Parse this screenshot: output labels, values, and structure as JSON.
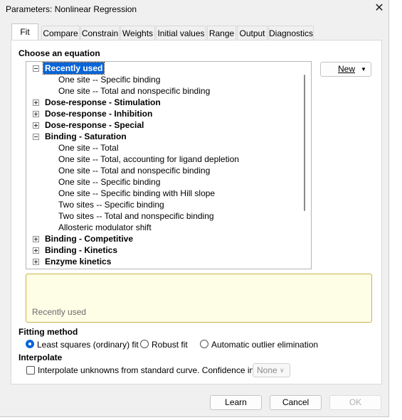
{
  "window": {
    "title": "Parameters: Nonlinear Regression",
    "close_glyph": "✕"
  },
  "tabs": [
    "Fit",
    "Compare",
    "Constrain",
    "Weights",
    "Initial values",
    "Range",
    "Output",
    "Diagnostics"
  ],
  "active_tab": "Fit",
  "choose_equation_label": "Choose an equation",
  "new_button": {
    "label": "New",
    "arrow": "▼"
  },
  "tree": [
    {
      "type": "category",
      "label": "Recently used",
      "expanded": true,
      "selected": true
    },
    {
      "type": "item",
      "label": "One site -- Specific binding"
    },
    {
      "type": "item",
      "label": "One site -- Total and nonspecific binding"
    },
    {
      "type": "category",
      "label": "Dose-response - Stimulation",
      "expanded": false
    },
    {
      "type": "category",
      "label": "Dose-response - Inhibition",
      "expanded": false
    },
    {
      "type": "category",
      "label": "Dose-response - Special",
      "expanded": false
    },
    {
      "type": "category",
      "label": "Binding - Saturation",
      "expanded": true
    },
    {
      "type": "item",
      "label": "One site -- Total"
    },
    {
      "type": "item",
      "label": "One site -- Total, accounting for ligand depletion"
    },
    {
      "type": "item",
      "label": "One site -- Total and nonspecific binding"
    },
    {
      "type": "item",
      "label": "One site -- Specific binding"
    },
    {
      "type": "item",
      "label": "One site -- Specific binding with Hill slope"
    },
    {
      "type": "item",
      "label": "Two sites -- Specific binding"
    },
    {
      "type": "item",
      "label": "Two sites -- Total and nonspecific binding"
    },
    {
      "type": "item",
      "label": "Allosteric modulator shift"
    },
    {
      "type": "category",
      "label": "Binding - Competitive",
      "expanded": false
    },
    {
      "type": "category",
      "label": "Binding - Kinetics",
      "expanded": false
    },
    {
      "type": "category",
      "label": "Enzyme kinetics",
      "expanded": false
    }
  ],
  "description": "Recently used",
  "fitting_method": {
    "label": "Fitting method",
    "options": [
      "Least squares (ordinary) fit",
      "Robust fit",
      "Automatic outlier elimination"
    ],
    "selected": "Least squares (ordinary) fit"
  },
  "interpolate": {
    "label": "Interpolate",
    "checkbox_label": "Interpolate unknowns from standard curve. Confidence interval:",
    "checked": false,
    "confidence_interval": "None",
    "combo_arrow": "∨"
  },
  "buttons": {
    "learn": "Learn",
    "cancel": "Cancel",
    "ok": "OK"
  },
  "colors": {
    "selection": "#0a64d8",
    "description_bg": "#fefde6",
    "description_border": "#c9b24a"
  }
}
